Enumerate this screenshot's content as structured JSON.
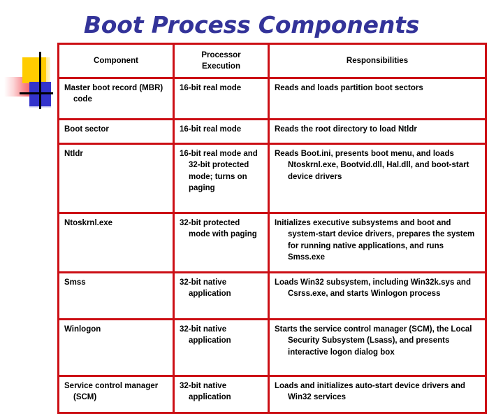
{
  "slide": {
    "title": "Boot Process Components",
    "title_color": "#333399",
    "table_border_color": "#cc0f15"
  },
  "decoration": {
    "name": "powerpoint-template-motif",
    "yellow": "#ffcc00",
    "blue": "#3333cc",
    "red": "#f4353d",
    "line": "#000000"
  },
  "table": {
    "headers": [
      "Component",
      "Processor Execution",
      "Responsibilities"
    ],
    "headers_display": {
      "component": "Component",
      "processor_line1": "Processor",
      "processor_line2": "Execution",
      "responsibilities": "Responsibilities"
    },
    "rows": [
      {
        "component": "Master boot record (MBR) code",
        "processor": "16-bit real mode",
        "responsibilities": "Reads and loads partition boot sectors"
      },
      {
        "component": "Boot sector",
        "processor": "16-bit real mode",
        "responsibilities": "Reads the root directory to load Ntldr"
      },
      {
        "component": "Ntldr",
        "processor": "16-bit real mode and 32-bit protected mode; turns on paging",
        "responsibilities": "Reads Boot.ini, presents boot menu, and loads Ntoskrnl.exe, Bootvid.dll, Hal.dll, and boot-start device drivers"
      },
      {
        "component": "Ntoskrnl.exe",
        "processor": "32-bit protected mode with paging",
        "responsibilities": "Initializes executive subsystems and boot and system-start device drivers, prepares the system for running native applications, and runs Smss.exe"
      },
      {
        "component": "Smss",
        "processor": "32-bit native application",
        "responsibilities": "Loads Win32 subsystem, including Win32k.sys and Csrss.exe, and starts Winlogon process"
      },
      {
        "component": "Winlogon",
        "processor": "32-bit native application",
        "responsibilities": "Starts the service control manager (SCM), the Local Security Subsystem (Lsass), and presents interactive logon dialog box"
      },
      {
        "component": "Service control manager (SCM)",
        "processor": "32-bit native application",
        "responsibilities": "Loads and initializes auto-start device drivers and Win32 services"
      }
    ]
  }
}
